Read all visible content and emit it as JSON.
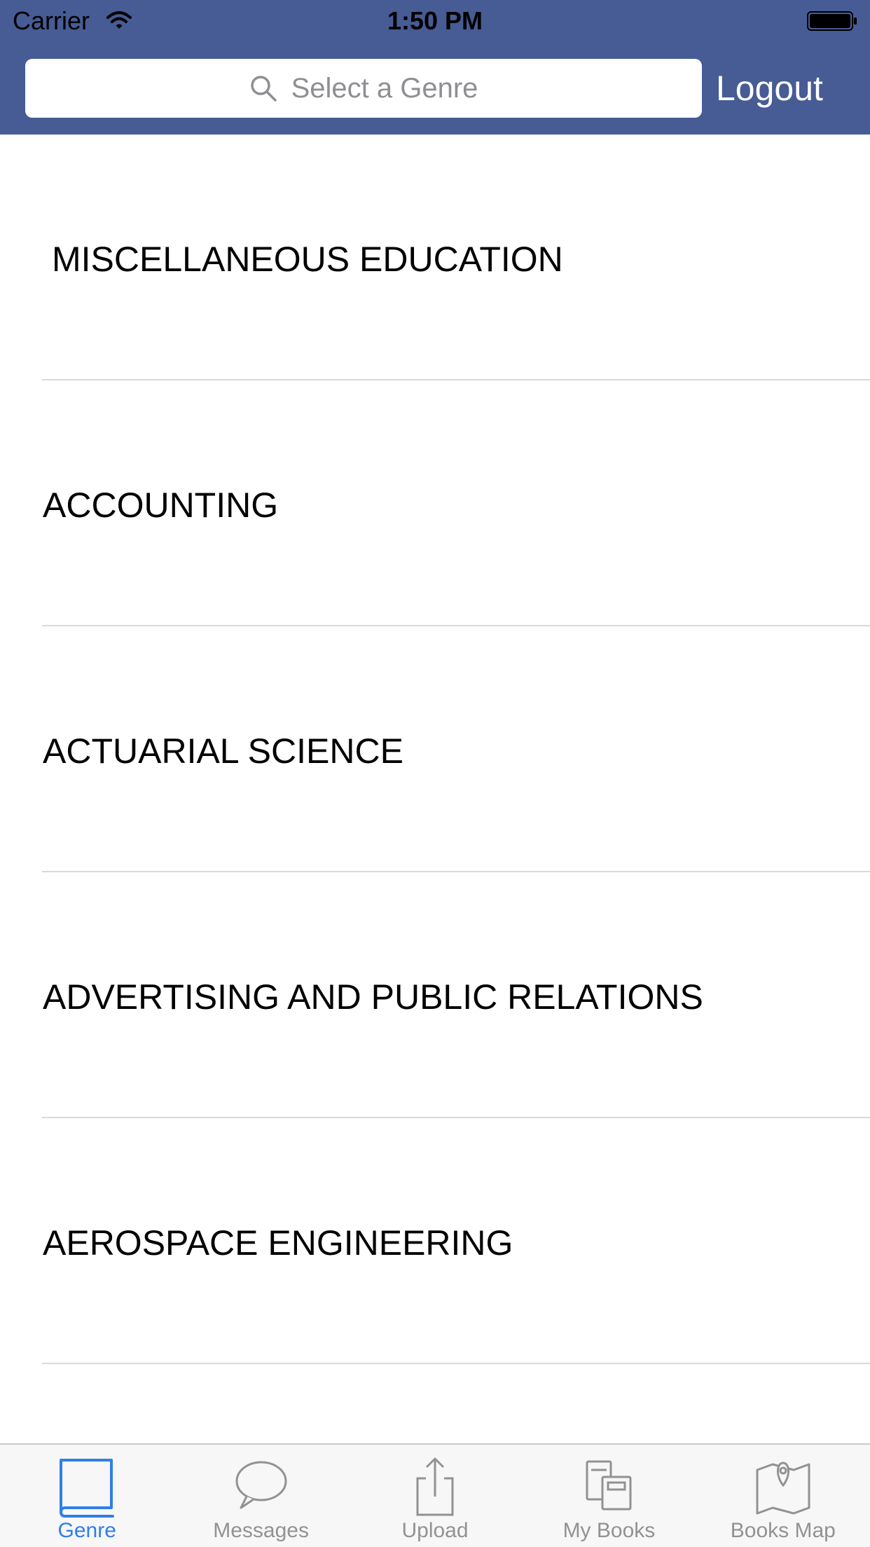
{
  "status_bar": {
    "carrier": "Carrier",
    "time": "1:50 PM",
    "icons": [
      "wifi-icon",
      "battery-icon"
    ]
  },
  "header": {
    "search_placeholder": "Select a Genre",
    "logout_label": "Logout",
    "background_color": "#475b95"
  },
  "genres": [
    "MISCELLANEOUS EDUCATION",
    "ACCOUNTING",
    "ACTUARIAL SCIENCE",
    "ADVERTISING AND PUBLIC RELATIONS",
    "AEROSPACE ENGINEERING"
  ],
  "tab_bar": {
    "active_color": "#2f7ee8",
    "inactive_color": "#929292",
    "tabs": [
      {
        "label": "Genre",
        "icon": "book-icon",
        "active": true
      },
      {
        "label": "Messages",
        "icon": "speech-bubble-icon",
        "active": false
      },
      {
        "label": "Upload",
        "icon": "share-upload-icon",
        "active": false
      },
      {
        "label": "My Books",
        "icon": "books-stack-icon",
        "active": false
      },
      {
        "label": "Books Map",
        "icon": "map-pin-icon",
        "active": false
      }
    ]
  }
}
